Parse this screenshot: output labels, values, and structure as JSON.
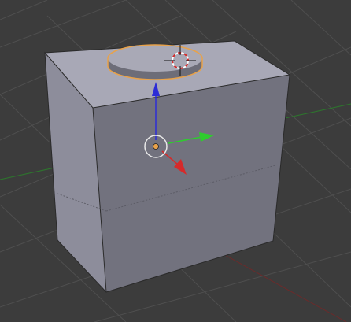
{
  "viewport": {
    "background_color": "#3c3c3c",
    "grid_color": "#4f4f4f",
    "x_axis_line_color": "#6a2b2b",
    "y_axis_line_color": "#2c7a2c"
  },
  "cube": {
    "top_color": "#a8a8b6",
    "left_color": "#8d8d9b",
    "front_color": "#72727e",
    "edge_color": "#2a2a2a"
  },
  "cylinder": {
    "top_color": "#a9a9b6",
    "side_color": "#6d6d78",
    "selection_outline_color": "#e8a24a"
  },
  "gizmo": {
    "x_arrow_color": "#d62a2a",
    "y_arrow_color": "#2ecc2e",
    "z_arrow_color": "#2c2cd6",
    "origin_color": "#e8a24a",
    "ring_color": "#e8e8e8"
  },
  "cursor_3d": {
    "ring_color_a": "#ffffff",
    "ring_color_b": "#d62a2a",
    "crosshair_color": "#111111"
  },
  "icons": [
    "3d-cursor-icon",
    "transform-gizmo-icon",
    "object-origin-icon"
  ]
}
